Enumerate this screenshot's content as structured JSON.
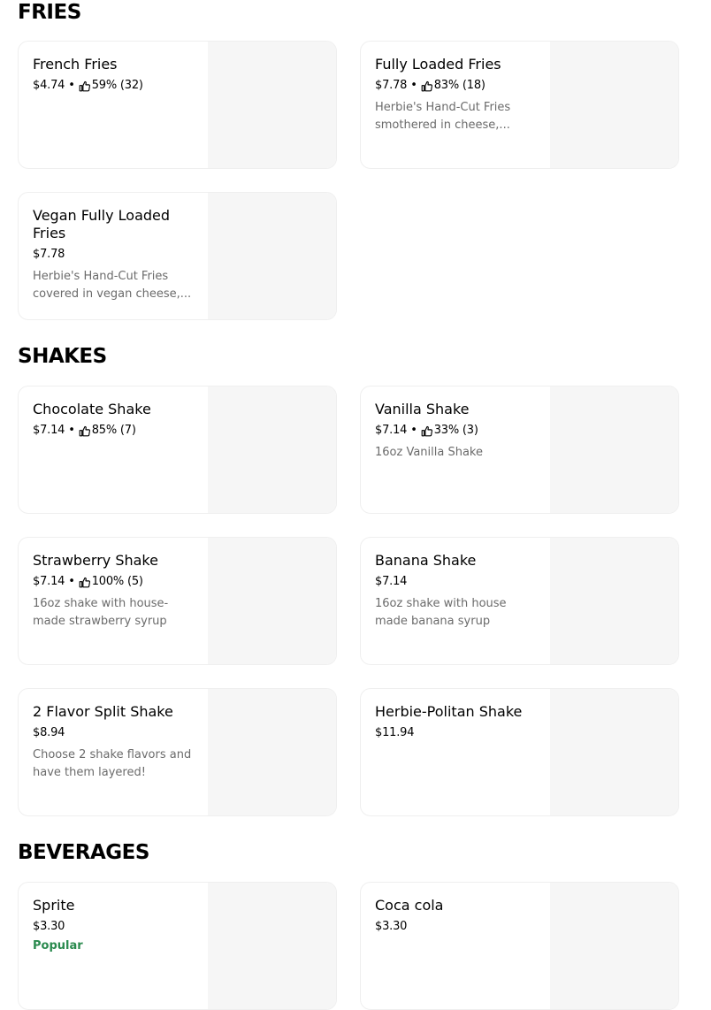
{
  "sections": [
    {
      "title": "FRIES",
      "items": [
        {
          "name": "French Fries",
          "price": "$4.74",
          "rating": "59% (32)"
        },
        {
          "name": "Fully Loaded Fries",
          "price": "$7.78",
          "rating": "83% (18)",
          "description": "Herbie's Hand-Cut Fries smothered in cheese,..."
        },
        {
          "name": "Vegan Fully Loaded Fries",
          "price": "$7.78",
          "description": "Herbie's Hand-Cut Fries covered in vegan cheese,..."
        }
      ]
    },
    {
      "title": "SHAKES",
      "items": [
        {
          "name": "Chocolate Shake",
          "price": "$7.14",
          "rating": "85% (7)"
        },
        {
          "name": "Vanilla Shake",
          "price": "$7.14",
          "rating": "33% (3)",
          "description": "16oz Vanilla Shake"
        },
        {
          "name": "Strawberry Shake",
          "price": "$7.14",
          "rating": "100% (5)",
          "description": "16oz shake with house-made strawberry syrup"
        },
        {
          "name": "Banana Shake",
          "price": "$7.14",
          "description": "16oz shake with house made banana syrup"
        },
        {
          "name": "2 Flavor Split Shake",
          "price": "$8.94",
          "description": "Choose 2 shake flavors and have them layered!"
        },
        {
          "name": "Herbie-Politan Shake",
          "price": "$11.94"
        }
      ]
    },
    {
      "title": "BEVERAGES",
      "items": [
        {
          "name": "Sprite",
          "price": "$3.30",
          "badge": "Popular"
        },
        {
          "name": "Coca cola",
          "price": "$3.30"
        }
      ]
    }
  ],
  "meta_separator": "•",
  "icons": {
    "rating": "thumbs-up-icon"
  },
  "colors": {
    "badge": "#2a8a4e",
    "description": "#6b6b6b",
    "image_placeholder": "#f6f6f6",
    "card_border": "#efefef"
  }
}
